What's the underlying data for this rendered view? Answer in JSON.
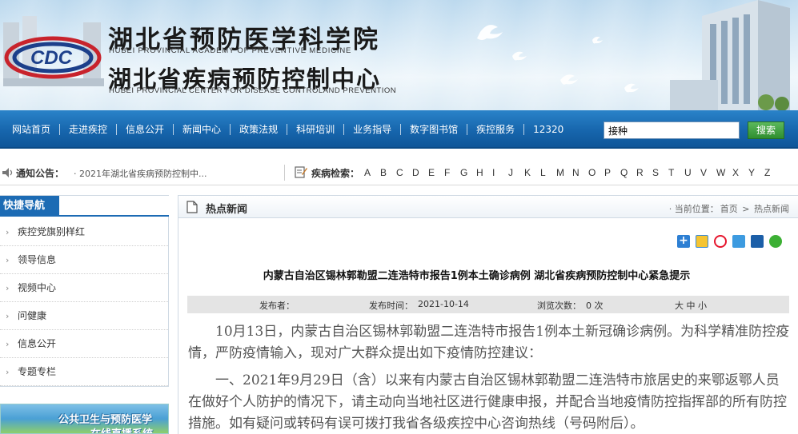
{
  "header": {
    "title_cn_1": "湖北省预防医学科学院",
    "title_en_1": "HUBEI PROVINCIAL ACADEMY OF PREVENTIVE MEDICINE",
    "title_cn_2": "湖北省疾病预防控制中心",
    "title_en_2": "HUBEI PROVINCIAL CENTER FOR DISEASE CONTROLAND PREVENTION",
    "logo_text": "CDC"
  },
  "nav": {
    "items": [
      "网站首页",
      "走进疾控",
      "信息公开",
      "新闻中心",
      "政策法规",
      "科研培训",
      "业务指导",
      "数字图书馆",
      "疾控服务",
      "12320"
    ],
    "search_value": "接种",
    "search_button": "搜索"
  },
  "notice": {
    "label": "通知公告：",
    "text": "· 2021年湖北省疾病预防控制中...",
    "disease_label": "疾病检索：",
    "letters": [
      "A",
      "B",
      "C",
      "D",
      "E",
      "F",
      "G",
      "H",
      "I",
      "J",
      "K",
      "L",
      "M",
      "N",
      "O",
      "P",
      "Q",
      "R",
      "S",
      "T",
      "U",
      "V",
      "W",
      "X",
      "Y",
      "Z"
    ]
  },
  "sidebar": {
    "title": "快捷导航",
    "items": [
      "疾控党旗别样红",
      "领导信息",
      "视频中心",
      "问健康",
      "信息公开",
      "专题专栏"
    ],
    "banner_line1": "公共卫生与预防医学",
    "banner_line2": "在线直播系统"
  },
  "main": {
    "section_title": "热点新闻",
    "breadcrumb_prefix": "· 当前位置：",
    "breadcrumb_home": "首页",
    "breadcrumb_sep": ">",
    "breadcrumb_current": "热点新闻",
    "article": {
      "title": "内蒙古自治区锡林郭勒盟二连浩特市报告1例本土确诊病例 湖北省疾病预防控制中心紧急提示",
      "publisher_label": "发布者：",
      "time_label": "发布时间：",
      "time_value": "2021-10-14",
      "views_label": "浏览次数：",
      "views_value": "0 次",
      "font_size_options": "大 中 小",
      "paragraphs": [
        "10月13日，内蒙古自治区锡林郭勒盟二连浩特市报告1例本土新冠确诊病例。为科学精准防控疫情，严防疫情输入，现对广大群众提出如下疫情防控建议：",
        "一、2021年9月29日（含）以来有内蒙古自治区锡林郭勒盟二连浩特市旅居史的来鄂返鄂人员在做好个人防护的情况下，请主动向当地社区进行健康申报，并配合当地疫情防控指挥部的所有防控措施。如有疑问或转码有误可拨打我省各级疾控中心咨询热线（号码附后）。"
      ]
    },
    "share_icons": [
      "plus-share-icon",
      "qzone-icon",
      "weibo-icon",
      "pengyou-icon",
      "renren-icon",
      "wechat-icon"
    ]
  },
  "colors": {
    "nav_blue": "#1766ad",
    "search_green": "#2f8f2f",
    "sidebar_blue": "#1c6bb4"
  }
}
